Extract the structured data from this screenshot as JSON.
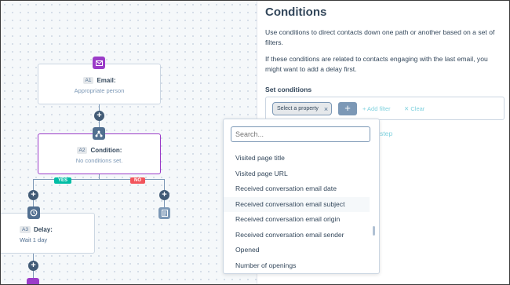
{
  "workflow": {
    "email_node": {
      "badge": "A1",
      "title": "Email:",
      "subtitle": "Appropriate person"
    },
    "condition_node": {
      "badge": "A2",
      "title": "Condition:",
      "subtitle": "No conditions set."
    },
    "branches": {
      "yes": "YES",
      "no": "NO"
    },
    "delay_node": {
      "badge": "A3",
      "title": "Delay:",
      "subtitle": "Wait 1 day"
    }
  },
  "panel": {
    "title": "Conditions",
    "description_1": "Use conditions to direct contacts down one path or another based on a set of filters.",
    "description_2": "If these conditions are related to contacts engaging with the last email, you might want to add a delay first.",
    "set_conditions_label": "Set conditions",
    "property_pill": "Select a property",
    "add_filter": "+ Add filter",
    "clear": "✕ Clear",
    "step_link": "step"
  },
  "dropdown": {
    "search_placeholder": "Search...",
    "options": [
      "Visited page title",
      "Visited page URL",
      "Received conversation email date",
      "Received conversation email subject",
      "Received conversation email origin",
      "Received conversation email sender",
      "Opened",
      "Number of openings"
    ],
    "hovered_index": 3
  },
  "colors": {
    "accent_purple": "#9b3cc8",
    "link_teal": "#7fd1de",
    "yes_green": "#00bda5",
    "no_red": "#f2545b"
  }
}
